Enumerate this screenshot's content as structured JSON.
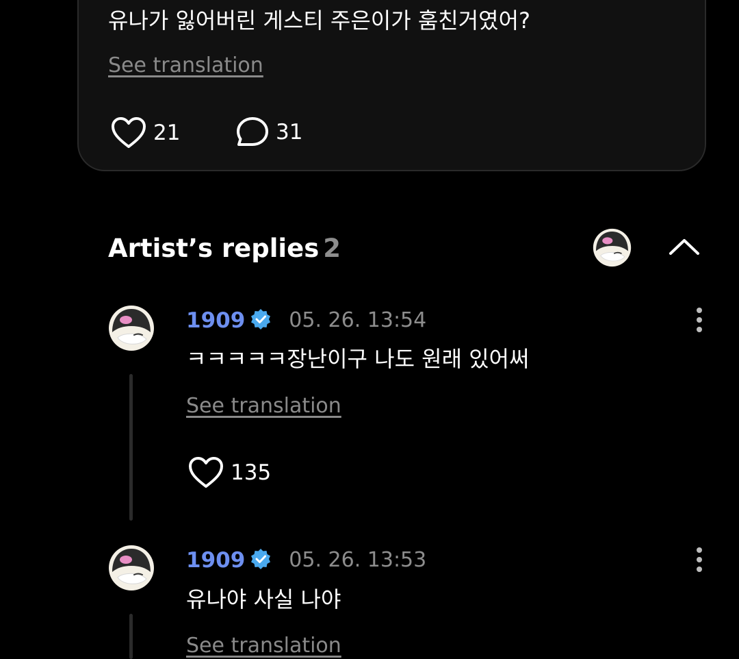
{
  "post": {
    "text": "유나가 잃어버린 게스티 주은이가 훔친거였어?",
    "see_translation": "See translation",
    "like_count": "21",
    "comment_count": "31"
  },
  "artist_replies": {
    "title": "Artist’s replies",
    "count": "2"
  },
  "replies": [
    {
      "author": "1909",
      "timestamp": "05. 26. 13:54",
      "text": "ㅋㅋㅋㅋㅋ장난이구 나도 원래 있어써",
      "see_translation": "See translation",
      "like_count": "135"
    },
    {
      "author": "1909",
      "timestamp": "05. 26. 13:53",
      "text": "유나야 사실 나야",
      "see_translation": "See translation"
    }
  ],
  "icons": {
    "like": "heart-outline-icon",
    "comment": "speech-bubble-icon",
    "verified": "verified-badge-icon",
    "more": "vertical-ellipsis-icon",
    "collapse": "chevron-up-icon"
  },
  "colors": {
    "background": "#000000",
    "card": "#111111",
    "author_blue": "#6d8ff0",
    "verified_badge": "#4aa9ee",
    "muted_text": "#8d8d8d"
  }
}
